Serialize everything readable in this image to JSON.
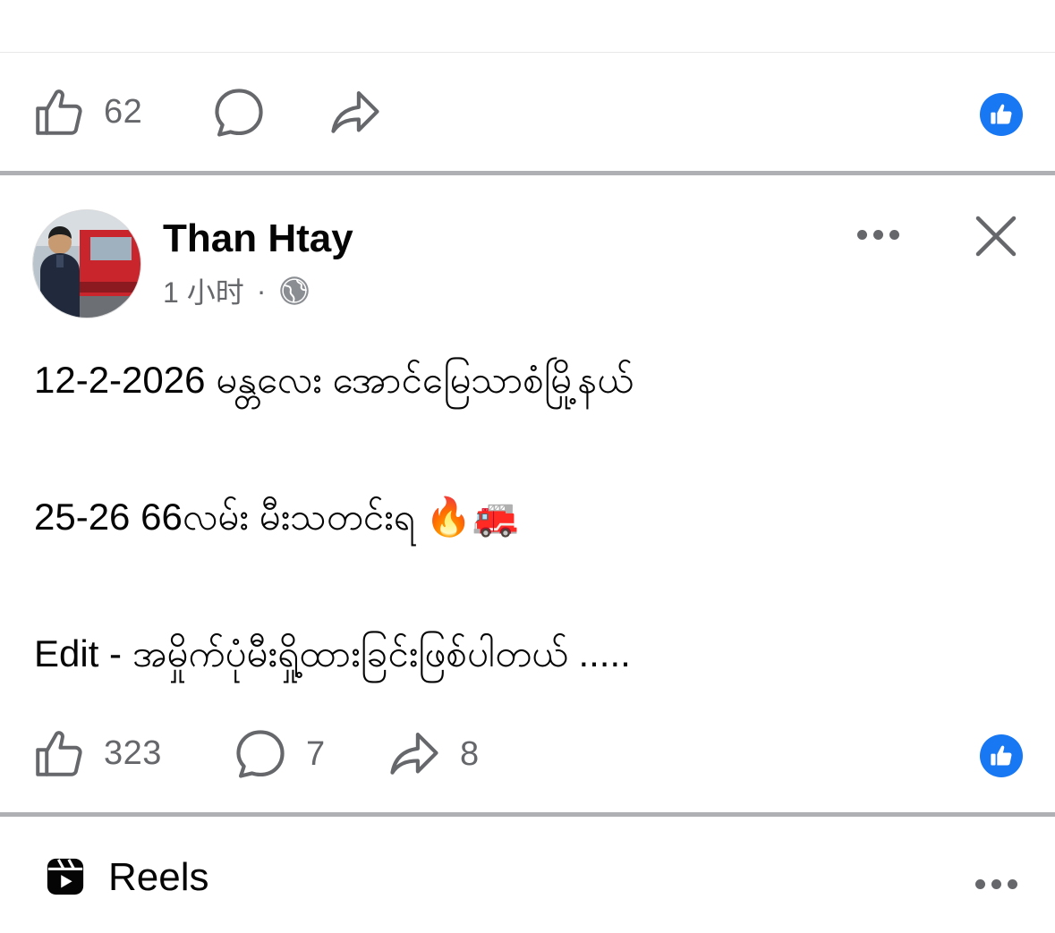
{
  "top_post": {
    "like_count": "62"
  },
  "post": {
    "author": "Than Htay",
    "time": "1 小时",
    "separator": "·",
    "lines": [
      "12-2-2026 မန္တလေး အောင်မြေသာစံမြို့နယ်",
      "25-26 66လမ်း မီးသတင်းရ 🔥🚒",
      "Edit - အမှိုက်ပုံမီးရှို့ထားခြင်းဖြစ်ပါတယ် ....."
    ],
    "like_count": "323",
    "comment_count": "7",
    "share_count": "8"
  },
  "reels": {
    "label": "Reels"
  },
  "colors": {
    "accent": "#1877f2",
    "icon_gray": "#65676b",
    "divider": "#aeb0b3"
  }
}
